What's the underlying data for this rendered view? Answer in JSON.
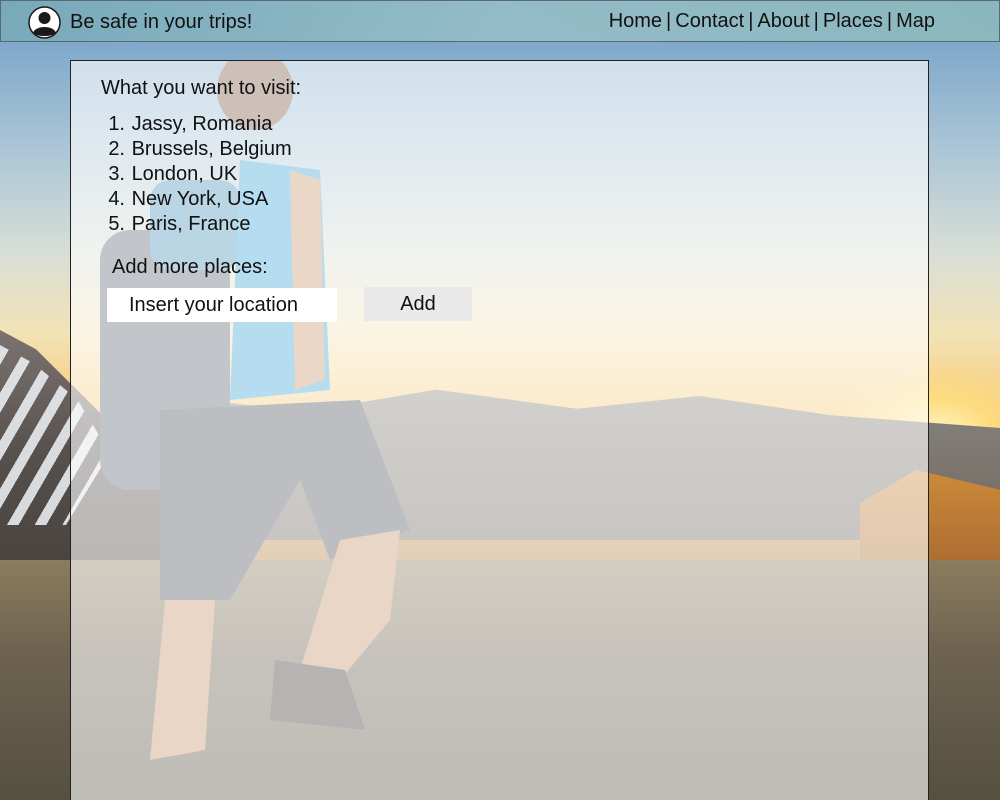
{
  "header": {
    "brand": "Be safe in your trips!",
    "logo_icon": "traveler-silhouette-icon",
    "nav": [
      {
        "label": "Home"
      },
      {
        "label": "Contact"
      },
      {
        "label": "About"
      },
      {
        "label": "Places"
      },
      {
        "label": "Map"
      }
    ],
    "separator": "|"
  },
  "main": {
    "heading": "What you want to visit:",
    "places": [
      {
        "number": "1.",
        "name": "Jassy, Romania"
      },
      {
        "number": "2.",
        "name": "Brussels, Belgium"
      },
      {
        "number": "3.",
        "name": "London, UK"
      },
      {
        "number": "4.",
        "name": "New York, USA"
      },
      {
        "number": "5.",
        "name": "Paris, France"
      }
    ],
    "add_label": "Add more places:",
    "location_input": {
      "value": "",
      "placeholder": "Insert your location"
    },
    "add_button": "Add"
  },
  "colors": {
    "header_bg": "#8fbcc6",
    "panel_bg": "#ffffff",
    "button_bg": "#e9e9e9",
    "text": "#111111"
  }
}
